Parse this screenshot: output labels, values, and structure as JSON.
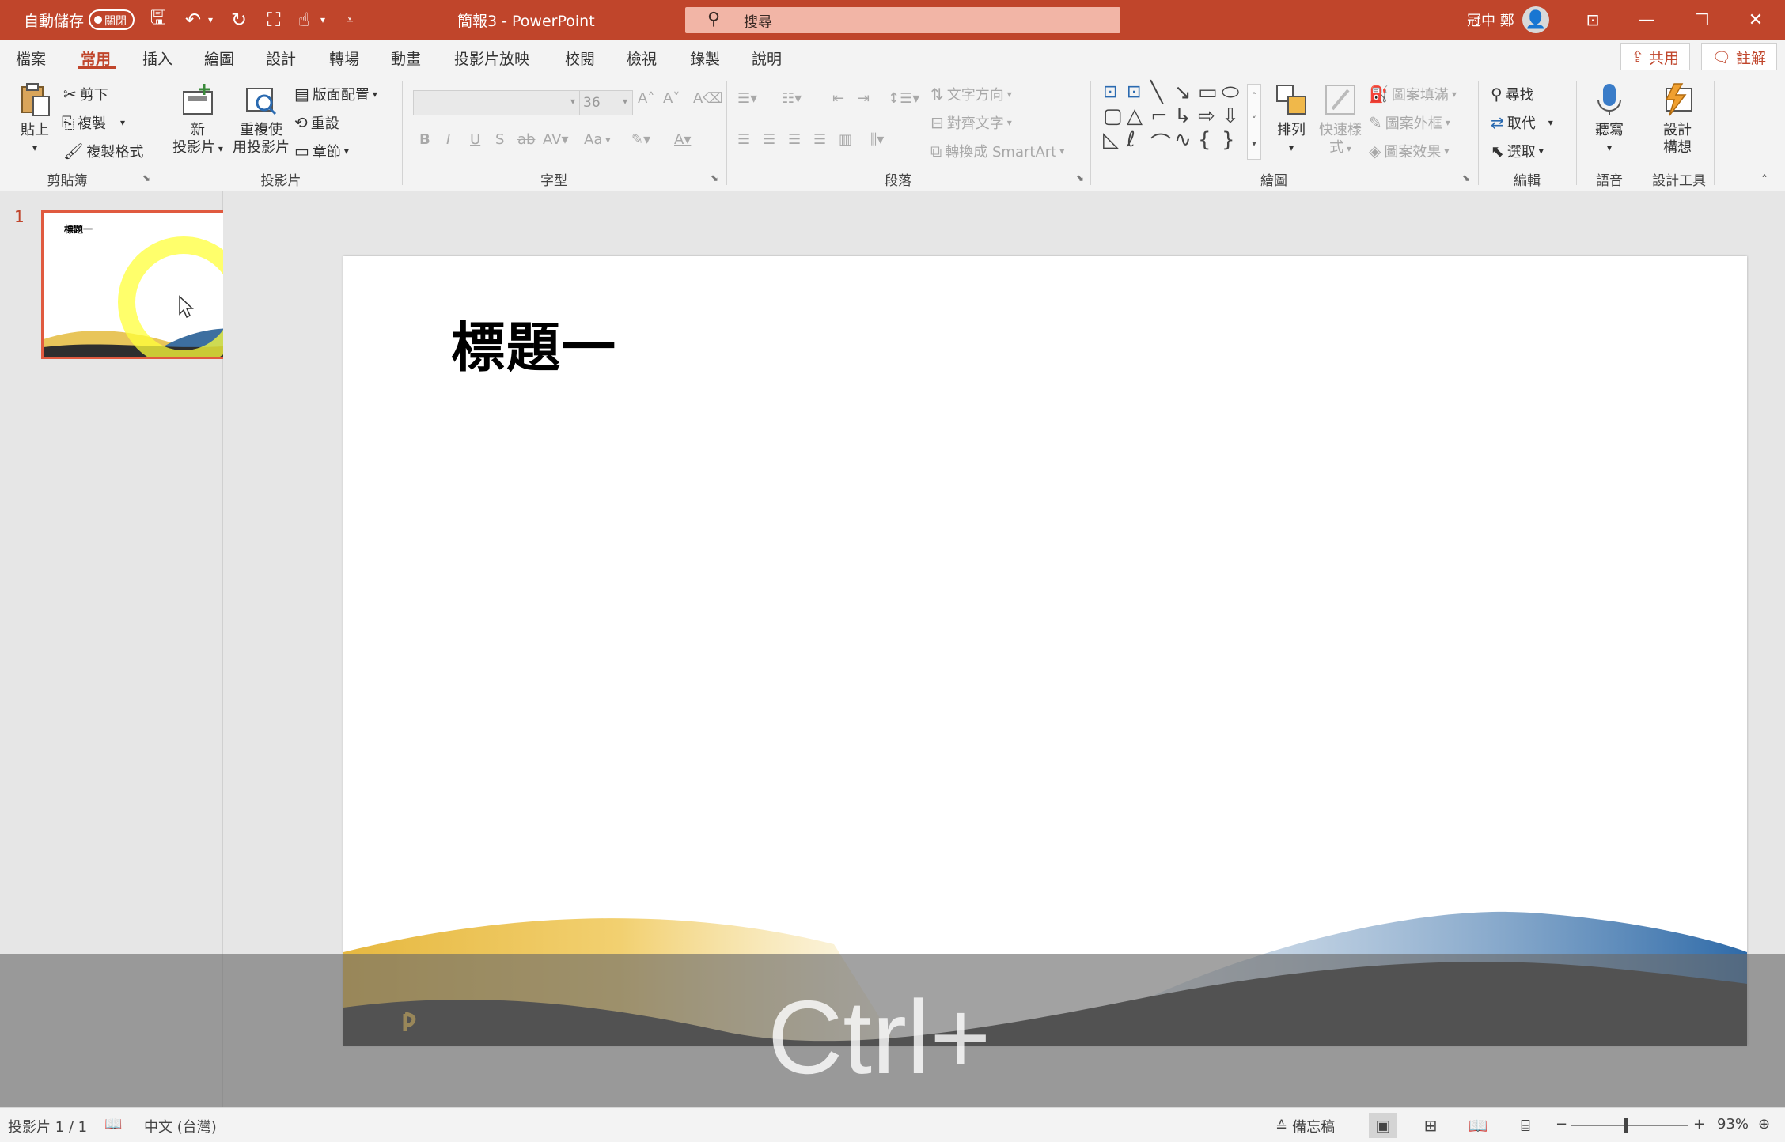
{
  "titlebar": {
    "autosave_label": "自動儲存",
    "autosave_state": "關閉",
    "doc_title": "簡報3  -  PowerPoint",
    "search_placeholder": "搜尋",
    "user_name": "冠中 鄭",
    "icons": [
      "save-icon",
      "undo-icon",
      "redo-icon",
      "present-icon",
      "touch-mode-icon",
      "customize-icon"
    ]
  },
  "tabs": [
    {
      "label": "檔案"
    },
    {
      "label": "常用"
    },
    {
      "label": "插入"
    },
    {
      "label": "繪圖"
    },
    {
      "label": "設計"
    },
    {
      "label": "轉場"
    },
    {
      "label": "動畫"
    },
    {
      "label": "投影片放映"
    },
    {
      "label": "校閱"
    },
    {
      "label": "檢視"
    },
    {
      "label": "錄製"
    },
    {
      "label": "說明"
    }
  ],
  "active_tab": "常用",
  "share_label": "共用",
  "comment_label": "註解",
  "ribbon": {
    "clipboard": {
      "label": "剪貼簿",
      "paste": "貼上",
      "cut": "剪下",
      "copy": "複製",
      "format_painter": "複製格式"
    },
    "slides": {
      "label": "投影片",
      "new_slide_1": "新",
      "new_slide_2": "投影片",
      "reuse_1": "重複使",
      "reuse_2": "用投影片",
      "layout": "版面配置",
      "reset": "重設",
      "section": "章節"
    },
    "font": {
      "label": "字型",
      "font_size": "36",
      "case": "Aa"
    },
    "paragraph": {
      "label": "段落",
      "text_direction": "文字方向",
      "align_text": "對齊文字",
      "smartart": "轉換成 SmartArt"
    },
    "drawing": {
      "label": "繪圖",
      "arrange": "排列",
      "quick_styles_1": "快速樣",
      "quick_styles_2": "式",
      "fill": "圖案填滿",
      "outline": "圖案外框",
      "effects": "圖案效果"
    },
    "editing": {
      "label": "編輯",
      "find": "尋找",
      "replace": "取代",
      "select": "選取"
    },
    "voice": {
      "label": "語音",
      "dictate": "聽寫"
    },
    "designer": {
      "label": "設計工具",
      "ideas_1": "設計",
      "ideas_2": "構想"
    }
  },
  "slides_panel": {
    "slide_number": "1",
    "thumb_title": "標題一"
  },
  "slide": {
    "title": "標題一"
  },
  "key_overlay": "Ctrl+",
  "status": {
    "slide_info": "投影片 1 / 1",
    "language": "中文 (台灣)",
    "notes": "備忘稿",
    "zoom": "93%"
  },
  "colors": {
    "accent": "#c0452b",
    "wave_gold": "#e8c55a",
    "wave_blue": "#3d6fa0",
    "wave_dark": "#2e2e2e"
  }
}
